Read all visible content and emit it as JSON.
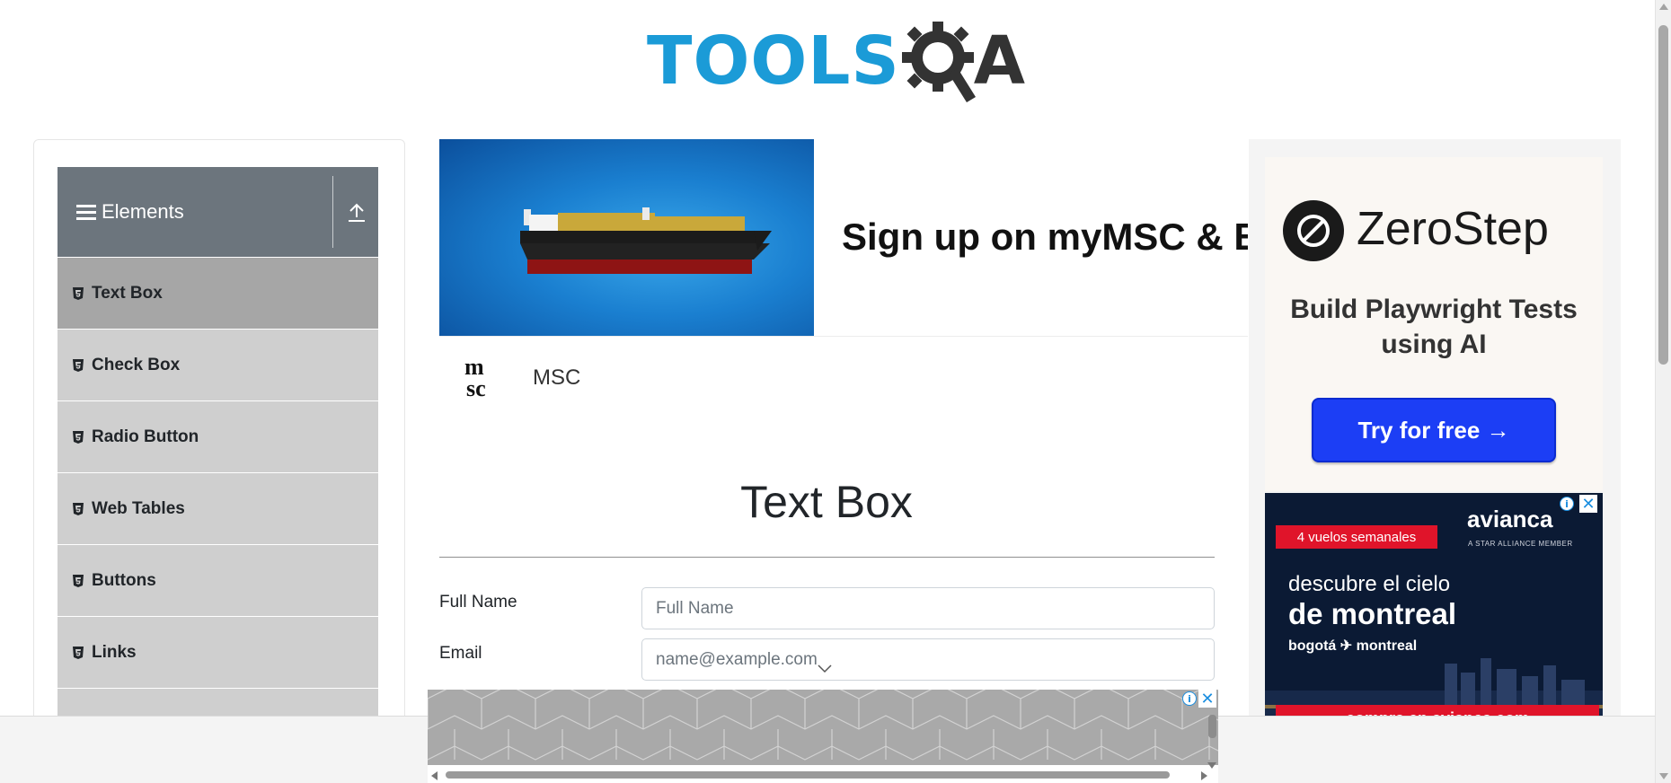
{
  "logo": {
    "text": "TOOLS",
    "suffix": "A",
    "brand_color": "#1b9bd7"
  },
  "sidebar": {
    "group_title": "Elements",
    "items": [
      {
        "label": "Text Box",
        "active": true
      },
      {
        "label": "Check Box",
        "active": false
      },
      {
        "label": "Radio Button",
        "active": false
      },
      {
        "label": "Web Tables",
        "active": false
      },
      {
        "label": "Buttons",
        "active": false
      },
      {
        "label": "Links",
        "active": false
      }
    ]
  },
  "banner_ad": {
    "headline": "Sign up on myMSC & B",
    "advertiser": "MSC",
    "logo_text": "msc"
  },
  "right_ad": {
    "brand": "ZeroStep",
    "tagline": "Build Playwright Tests using AI",
    "cta": "Try for free →",
    "cta_color": "#1c3ef5"
  },
  "avianca_ad": {
    "badge": "4 vuelos semanales",
    "brand": "avianca",
    "member": "A STAR ALLIANCE MEMBER",
    "line1": "descubre el cielo",
    "line2": "de montreal",
    "route": "bogotá ✈ montreal",
    "cta": "compra en avianca.com"
  },
  "page": {
    "title": "Text Box",
    "full_name_label": "Full Name",
    "full_name_placeholder": "Full Name",
    "email_label": "Email",
    "email_placeholder": "name@example.com"
  },
  "ad_controls": {
    "info": "i",
    "close": "✕"
  }
}
